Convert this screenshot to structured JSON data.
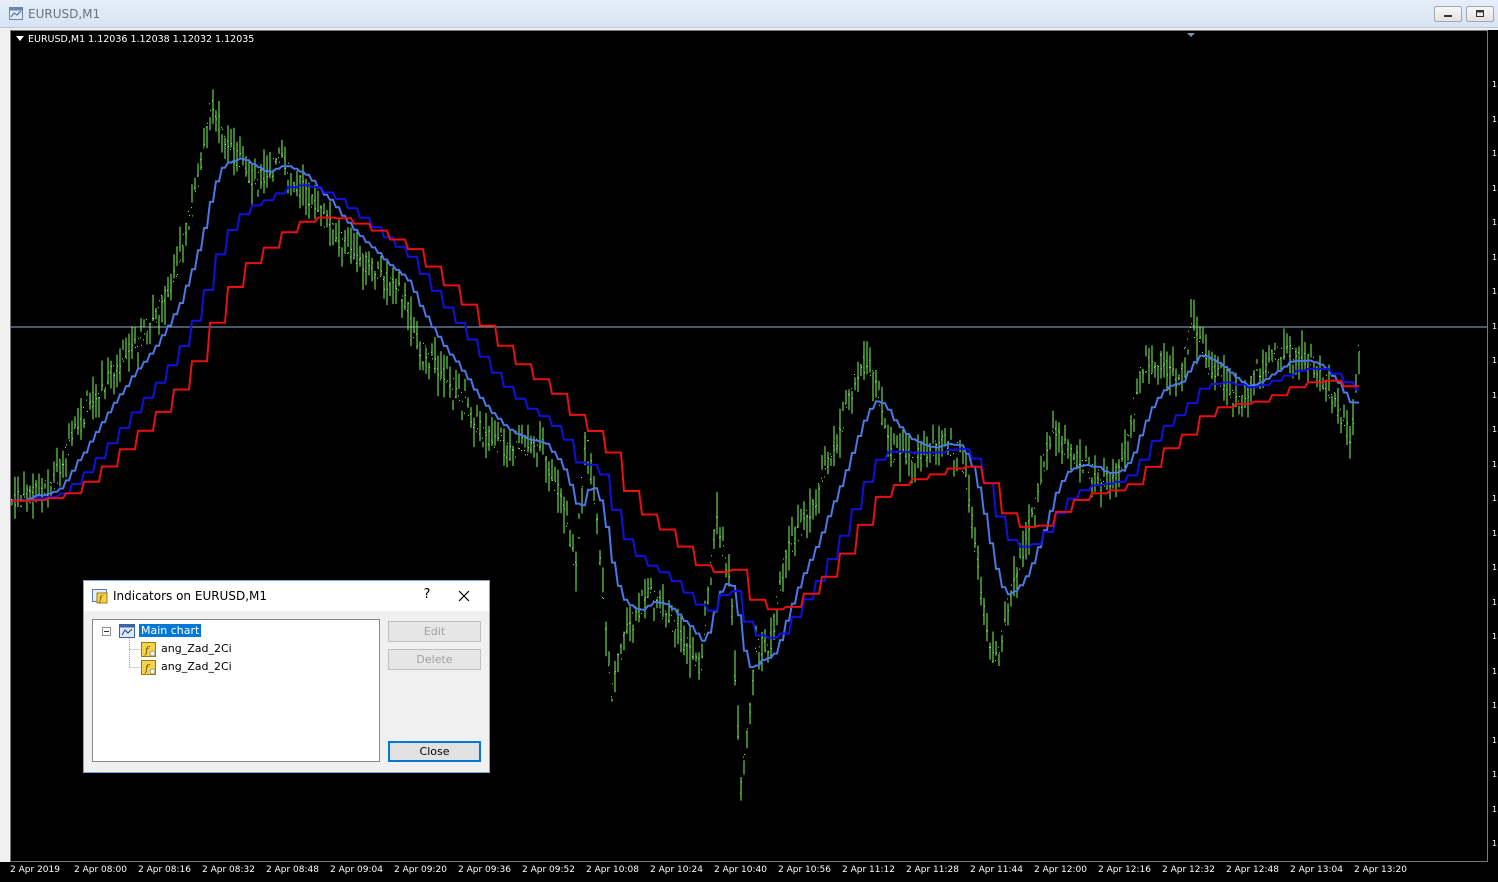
{
  "window": {
    "title": "EURUSD,M1"
  },
  "chart": {
    "header_text": "EURUSD,M1  1.12036 1.12038 1.12032 1.12035",
    "right_scale_label": "1",
    "time_labels": [
      "2 Apr 2019",
      "2 Apr 08:00",
      "2 Apr 08:16",
      "2 Apr 08:32",
      "2 Apr 08:48",
      "2 Apr 09:04",
      "2 Apr 09:20",
      "2 Apr 09:36",
      "2 Apr 09:52",
      "2 Apr 10:08",
      "2 Apr 10:24",
      "2 Apr 10:40",
      "2 Apr 10:56",
      "2 Apr 11:12",
      "2 Apr 11:28",
      "2 Apr 11:44",
      "2 Apr 12:00",
      "2 Apr 12:16",
      "2 Apr 12:32",
      "2 Apr 12:48",
      "2 Apr 13:04",
      "2 Apr 13:20"
    ],
    "colors": {
      "background": "#000000",
      "bars": "#7cfc5a",
      "fast_line": "#4a78e8",
      "mid_line": "#1010e0",
      "slow_line": "#e81010",
      "price_line": "#8fb0d0"
    }
  },
  "dialog": {
    "title": "Indicators on EURUSD,M1",
    "help_label": "?",
    "tree": {
      "root_label": "Main chart",
      "items": [
        "ang_Zad_2Ci",
        "ang_Zad_2Ci"
      ]
    },
    "buttons": {
      "edit": "Edit",
      "delete": "Delete",
      "close": "Close"
    }
  }
}
